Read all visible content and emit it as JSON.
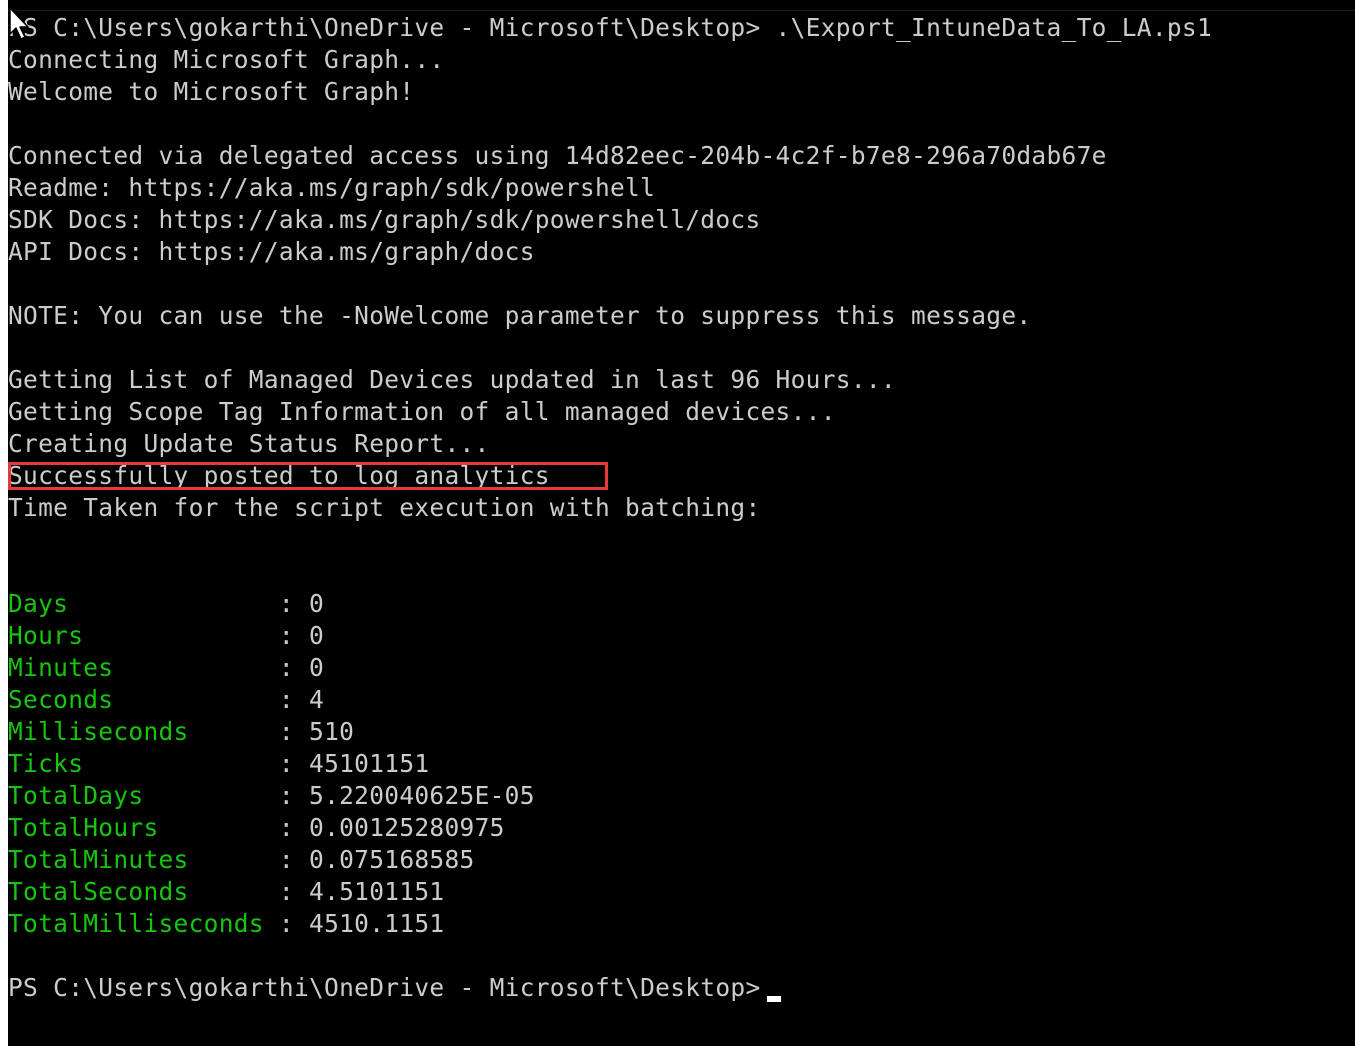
{
  "terminal": {
    "lines": [
      "PS C:\\Users\\gokarthi\\OneDrive - Microsoft\\Desktop> .\\Export_IntuneData_To_LA.ps1",
      "Connecting Microsoft Graph...",
      "Welcome to Microsoft Graph!",
      "",
      "Connected via delegated access using 14d82eec-204b-4c2f-b7e8-296a70dab67e",
      "Readme: https://aka.ms/graph/sdk/powershell",
      "SDK Docs: https://aka.ms/graph/sdk/powershell/docs",
      "API Docs: https://aka.ms/graph/docs",
      "",
      "NOTE: You can use the -NoWelcome parameter to suppress this message.",
      "",
      "Getting List of Managed Devices updated in last 96 Hours...",
      "Getting Scope Tag Information of all managed devices...",
      "Creating Update Status Report...",
      "Successfully posted to log analytics",
      "Time Taken for the script execution with batching:",
      "",
      ""
    ],
    "timespan": [
      {
        "name": "Days             ",
        "value": "0"
      },
      {
        "name": "Hours            ",
        "value": "0"
      },
      {
        "name": "Minutes          ",
        "value": "0"
      },
      {
        "name": "Seconds          ",
        "value": "4"
      },
      {
        "name": "Milliseconds     ",
        "value": "510"
      },
      {
        "name": "Ticks            ",
        "value": "45101151"
      },
      {
        "name": "TotalDays        ",
        "value": "5.220040625E-05"
      },
      {
        "name": "TotalHours       ",
        "value": "0.00125280975"
      },
      {
        "name": "TotalMinutes     ",
        "value": "0.075168585"
      },
      {
        "name": "TotalSeconds     ",
        "value": "4.5101151"
      },
      {
        "name": "TotalMilliseconds",
        "value": "4510.1151"
      }
    ],
    "prompt": "PS C:\\Users\\gokarthi\\OneDrive - Microsoft\\Desktop>",
    "separator": " : "
  },
  "colors": {
    "background": "#000000",
    "text": "#cccccc",
    "property_name": "#16c60c",
    "highlight_box": "#e83a3a"
  },
  "icons": {
    "pointer": "mouse-pointer-icon",
    "cursor": "text-cursor-icon"
  }
}
